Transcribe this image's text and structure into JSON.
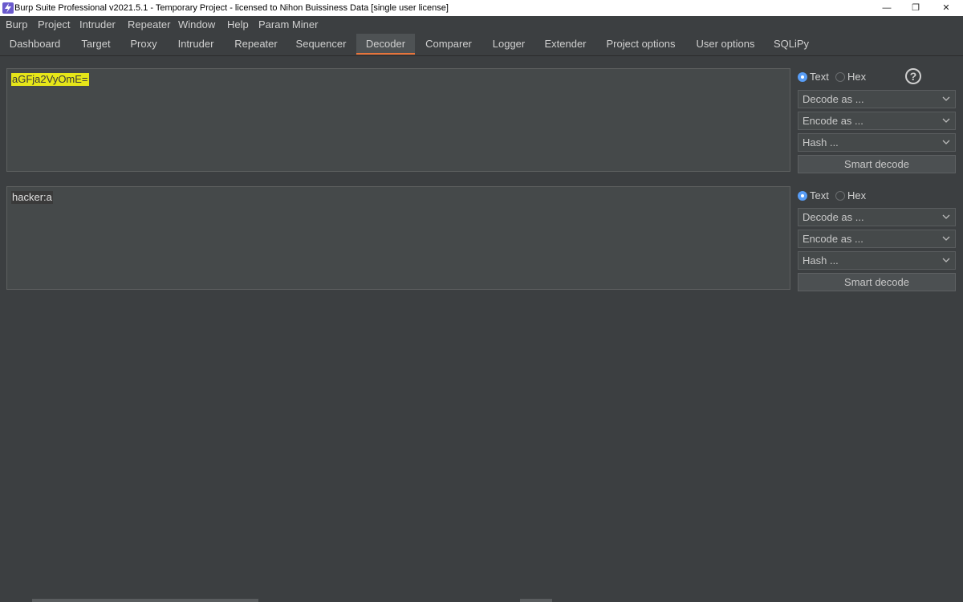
{
  "window": {
    "title": "Burp Suite Professional v2021.5.1 - Temporary Project - licensed to Nihon Buissiness Data [single user license]",
    "minimize": "—",
    "restore": "❐",
    "close": "✕"
  },
  "menu": [
    "Burp",
    "Project",
    "Intruder",
    "Repeater",
    "Window",
    "Help",
    "Param Miner"
  ],
  "tabs": [
    {
      "label": "Dashboard"
    },
    {
      "label": "Target"
    },
    {
      "label": "Proxy"
    },
    {
      "label": "Intruder"
    },
    {
      "label": "Repeater"
    },
    {
      "label": "Sequencer"
    },
    {
      "label": "Decoder",
      "active": true
    },
    {
      "label": "Comparer"
    },
    {
      "label": "Logger"
    },
    {
      "label": "Extender"
    },
    {
      "label": "Project options"
    },
    {
      "label": "User options"
    },
    {
      "label": "SQLiPy"
    }
  ],
  "colors": {
    "accent": "#e8743b",
    "highlight": "#e6e619",
    "radio_on": "#589df6"
  },
  "panels": [
    {
      "content": "aGFja2VyOmE=",
      "text_label": "Text",
      "hex_label": "Hex",
      "selected_mode": "Text",
      "decode_label": "Decode as ...",
      "encode_label": "Encode as ...",
      "hash_label": "Hash ...",
      "smart_decode_label": "Smart decode",
      "help_icon": "?"
    },
    {
      "content": "hacker:a",
      "text_label": "Text",
      "hex_label": "Hex",
      "selected_mode": "Text",
      "decode_label": "Decode as ...",
      "encode_label": "Encode as ...",
      "hash_label": "Hash ...",
      "smart_decode_label": "Smart decode"
    }
  ]
}
